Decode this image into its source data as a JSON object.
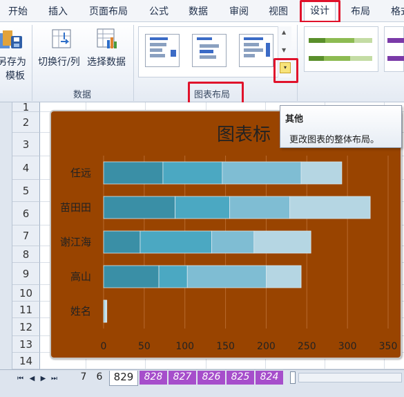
{
  "ribbon_tabs": [
    "开始",
    "插入",
    "页面布局",
    "公式",
    "数据",
    "审阅",
    "视图",
    "设计",
    "布局",
    "格式"
  ],
  "active_tab": "设计",
  "ribbon": {
    "save_template": {
      "line1": "另存为",
      "line2": "模板"
    },
    "switch_row_col": "切换行/列",
    "select_data": "选择数据",
    "data_group_label": "数据",
    "chart_layout_group_label": "图表布局",
    "more_button_icon": "more-dropdown-icon"
  },
  "tooltip": {
    "title": "其他",
    "body": "更改图表的整体布局。"
  },
  "row_headers": [
    "1",
    "2",
    "3",
    "4",
    "5",
    "6",
    "7",
    "8",
    "9",
    "10",
    "11",
    "12",
    "13",
    "14"
  ],
  "chart_data": {
    "type": "bar",
    "stacked": true,
    "orientation": "horizontal",
    "title": "图表标",
    "categories": [
      "任远",
      "苗田田",
      "谢江海",
      "高山",
      "姓名"
    ],
    "series": [
      {
        "values": [
          73,
          88,
          45,
          68,
          1
        ],
        "color": "#3a8fa6"
      },
      {
        "values": [
          73,
          67,
          88,
          35,
          1
        ],
        "color": "#4ba8c2"
      },
      {
        "values": [
          97,
          74,
          52,
          97,
          1
        ],
        "color": "#7fbdd3"
      },
      {
        "values": [
          50,
          99,
          70,
          43,
          1
        ],
        "color": "#b5d6e3"
      }
    ],
    "xticks": [
      "0",
      "50",
      "100",
      "150",
      "200",
      "250",
      "300",
      "350"
    ],
    "xlim": [
      0,
      350
    ],
    "grid": true,
    "background": "#994400"
  },
  "sheet_tabs": [
    "7",
    "6",
    "829",
    "828",
    "827",
    "826",
    "825",
    "824"
  ],
  "active_sheet": "829",
  "colors": {
    "highlight": "#e0122b",
    "sheet_tab_violet": "#a64ecb"
  }
}
